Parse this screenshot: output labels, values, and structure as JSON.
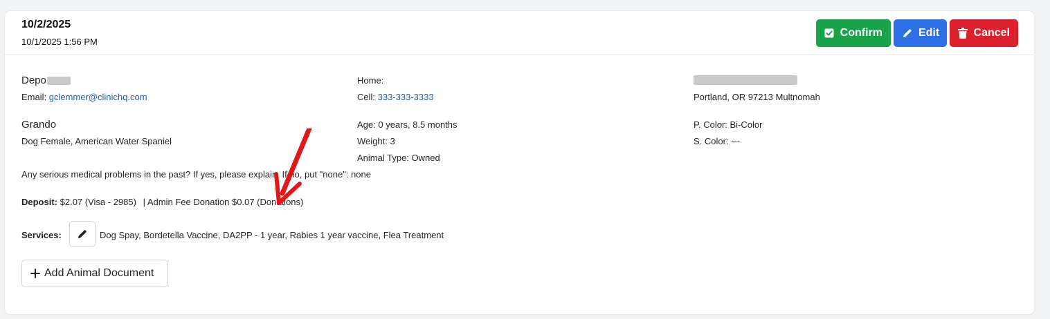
{
  "header": {
    "date": "10/2/2025",
    "datetime": "10/1/2025 1:56 PM"
  },
  "actions": {
    "confirm_label": "Confirm",
    "edit_label": "Edit",
    "cancel_label": "Cancel"
  },
  "client": {
    "name_visible": "Depo",
    "email_label": "Email:",
    "email": "gclemmer@clinichq.com",
    "home_label": "Home:",
    "cell_label": "Cell:",
    "cell": "333-333-3333",
    "city_line": "Portland, OR 97213 Multnomah"
  },
  "animal": {
    "name": "Grando",
    "description": "Dog Female, American Water Spaniel",
    "age": "Age: 0 years, 8.5 months",
    "weight": "Weight: 3",
    "type": "Animal Type: Owned",
    "primary_color": "P. Color: Bi-Color",
    "secondary_color": "S. Color: ---"
  },
  "medical_question": "Any serious medical problems in the past? If yes, please explain. If no, put \"none\": none",
  "deposit": {
    "label": "Deposit:",
    "value": "$2.07 (Visa - 2985)",
    "separator": "|",
    "admin_fee": "Admin Fee Donation $0.07 (Donations)"
  },
  "services": {
    "label": "Services:",
    "list": "Dog Spay, Bordetella Vaccine, DA2PP - 1 year, Rabies 1 year vaccine, Flea Treatment"
  },
  "add_document_label": "Add Animal Document",
  "colors": {
    "confirm": "#18a34a",
    "edit": "#2f6fe6",
    "cancel": "#dc1f2d",
    "link": "#245f9b",
    "annotation_arrow": "#e01818"
  }
}
